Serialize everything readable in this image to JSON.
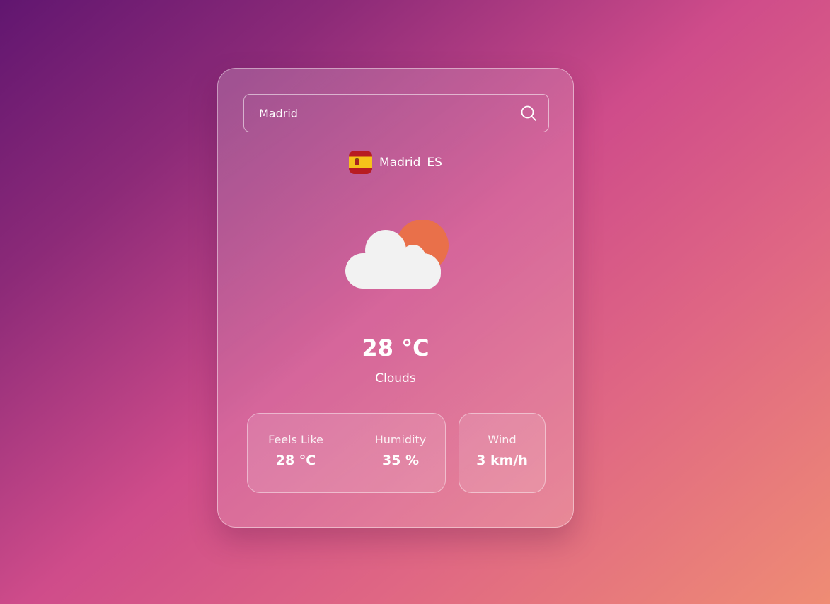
{
  "search": {
    "value": "Madrid",
    "placeholder": ""
  },
  "location": {
    "city": "Madrid",
    "country": "ES",
    "flag_icon": "spain-flag-icon"
  },
  "weather": {
    "icon": "cloud-sun-icon",
    "temperature": "28 °C",
    "description": "Clouds"
  },
  "stats": {
    "feels_like_label": "Feels Like",
    "feels_like_value": "28 °C",
    "humidity_label": "Humidity",
    "humidity_value": "35 %",
    "wind_label": "Wind",
    "wind_value": "3 km/h"
  },
  "colors": {
    "sun": "#e9704a",
    "cloud": "#f2f2f2",
    "text": "#ffffff"
  }
}
